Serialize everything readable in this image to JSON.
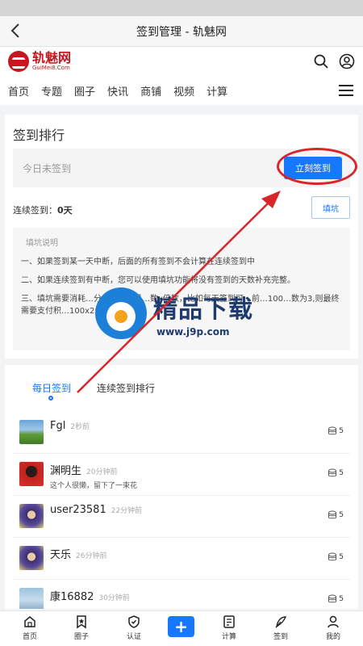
{
  "window": {
    "title": "签到管理 - 轨魅网"
  },
  "brand": {
    "name": "轨魅网",
    "sub": "GuiMei8.Com",
    "color": "#c8161e"
  },
  "nav": {
    "items": [
      "首页",
      "专题",
      "圈子",
      "快讯",
      "商铺",
      "视频",
      "计算"
    ]
  },
  "sign": {
    "section_title": "签到排行",
    "status_text": "今日未签到",
    "sign_button": "立刻签到",
    "streak_label": "连续签到：",
    "streak_value": "0天",
    "fill_button": "填坑"
  },
  "help": {
    "title": "填坑说明",
    "items": [
      "一、如果签到某一天中断，后面的所有签到不会计算在连续签到中",
      "二、如果连续签到有中断，您可以使用填坑功能将没有签到的天数补充完整。",
      "三、填坑需要消耗…分，…方法是…数x倍数，比如每天签到可…前…100…数为3,则最终需要支付积…100x2x…积分。"
    ]
  },
  "watermark": {
    "text": "精品下载",
    "url": "www.j9p.com"
  },
  "tabs": {
    "daily": "每日签到",
    "streak": "连续签到排行"
  },
  "list": [
    {
      "name": "Fgl",
      "time": "2秒前",
      "note": "",
      "points": "5"
    },
    {
      "name": "渊明生",
      "time": "20分钟前",
      "note": "这个人很懒，留下了一束花",
      "points": "5"
    },
    {
      "name": "user23581",
      "time": "22分钟前",
      "note": "",
      "points": "5"
    },
    {
      "name": "天乐",
      "time": "26分钟前",
      "note": "",
      "points": "5"
    },
    {
      "name": "康16882",
      "time": "30分钟前",
      "note": "",
      "points": "5"
    }
  ],
  "tabbar": {
    "home": "首页",
    "circle": "圈子",
    "cert": "认证",
    "plus": "+",
    "calc": "计算",
    "sign": "签到",
    "me": "我的"
  },
  "colors": {
    "accent": "#1677ff",
    "annotation": "#d9252a"
  }
}
